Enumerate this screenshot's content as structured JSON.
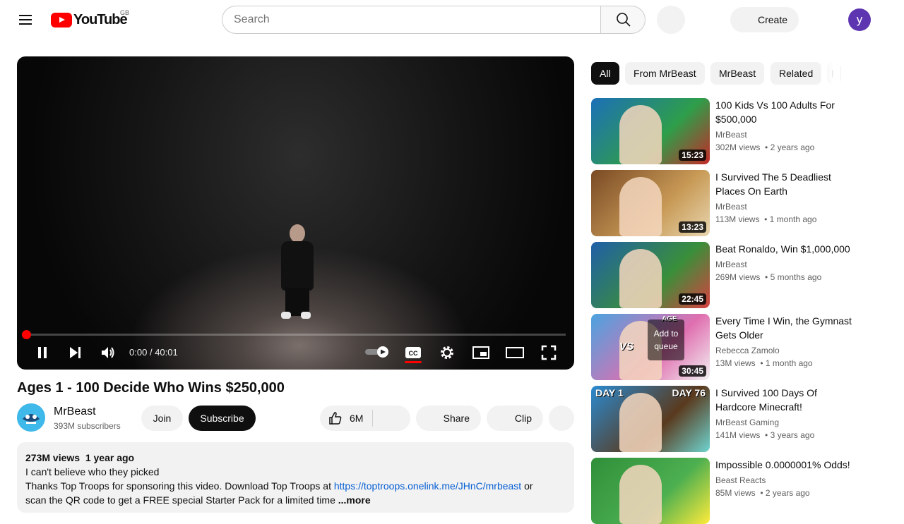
{
  "masthead": {
    "logo_text": "YouTube",
    "region": "GB",
    "search_placeholder": "Search",
    "create_label": "Create",
    "avatar_letter": "y"
  },
  "player": {
    "time_current": "0:00",
    "time_separator": "/",
    "time_total": "40:01",
    "progress_fraction": 0,
    "autoplay_on": true,
    "captions_on": true
  },
  "video": {
    "title": "Ages 1 - 100 Decide Who Wins $250,000",
    "channel_name": "MrBeast",
    "subscribers": "393M subscribers",
    "join_label": "Join",
    "subscribe_label": "Subscribe",
    "like_count": "6M",
    "share_label": "Share",
    "clip_label": "Clip"
  },
  "description": {
    "views": "273M views",
    "date": "1 year ago",
    "line1": "I can't believe who they picked",
    "line2_prefix": "Thanks Top Troops for sponsoring this video. Download Top Troops at ",
    "link": "https://toptroops.onelink.me/JHnC/mrbeast",
    "line2_suffix": " or",
    "line3": "scan the QR code to get a FREE special Starter Pack for a limited time ",
    "more_label": "...more"
  },
  "chips": [
    "All",
    "From MrBeast",
    "MrBeast",
    "Related",
    "R"
  ],
  "recommendations": [
    {
      "title": "100 Kids Vs 100 Adults For $500,000",
      "channel": "MrBeast",
      "views": "302M views",
      "age": "2 years ago",
      "duration": "15:23",
      "colors": [
        "#1c6fb8",
        "#2e9e4a",
        "#c62828"
      ]
    },
    {
      "title": "I Survived The 5 Deadliest Places On Earth",
      "channel": "MrBeast",
      "views": "113M views",
      "age": "1 month ago",
      "duration": "13:23",
      "colors": [
        "#7a4a24",
        "#c89a56",
        "#e8d6b0"
      ]
    },
    {
      "title": "Beat Ronaldo, Win $1,000,000",
      "channel": "MrBeast",
      "views": "269M views",
      "age": "5 months ago",
      "duration": "22:45",
      "colors": [
        "#1f5fa8",
        "#3a8f3a",
        "#d94040"
      ]
    },
    {
      "title": "Every Time I Win, the Gymnast Gets Older",
      "channel": "Rebecca Zamolo",
      "views": "13M views",
      "age": "1 month ago",
      "duration": "30:45",
      "colors": [
        "#4aa3e0",
        "#e06fb0",
        "#f2f2f2"
      ],
      "overlay": "Add to queue",
      "badge": "AGE",
      "vs": "VS"
    },
    {
      "title": "I Survived 100 Days Of Hardcore Minecraft!",
      "channel": "MrBeast Gaming",
      "views": "141M views",
      "age": "3 years ago",
      "duration": "",
      "colors": [
        "#2a8ad0",
        "#5a3a1e",
        "#6ed4d0"
      ],
      "labels": [
        "DAY 1",
        "DAY 76"
      ]
    },
    {
      "title": "Impossible 0.0000001% Odds!",
      "channel": "Beast Reacts",
      "views": "85M views",
      "age": "2 years ago",
      "duration": "",
      "colors": [
        "#2f8f3a",
        "#4caf50",
        "#ffeb3b"
      ]
    }
  ]
}
